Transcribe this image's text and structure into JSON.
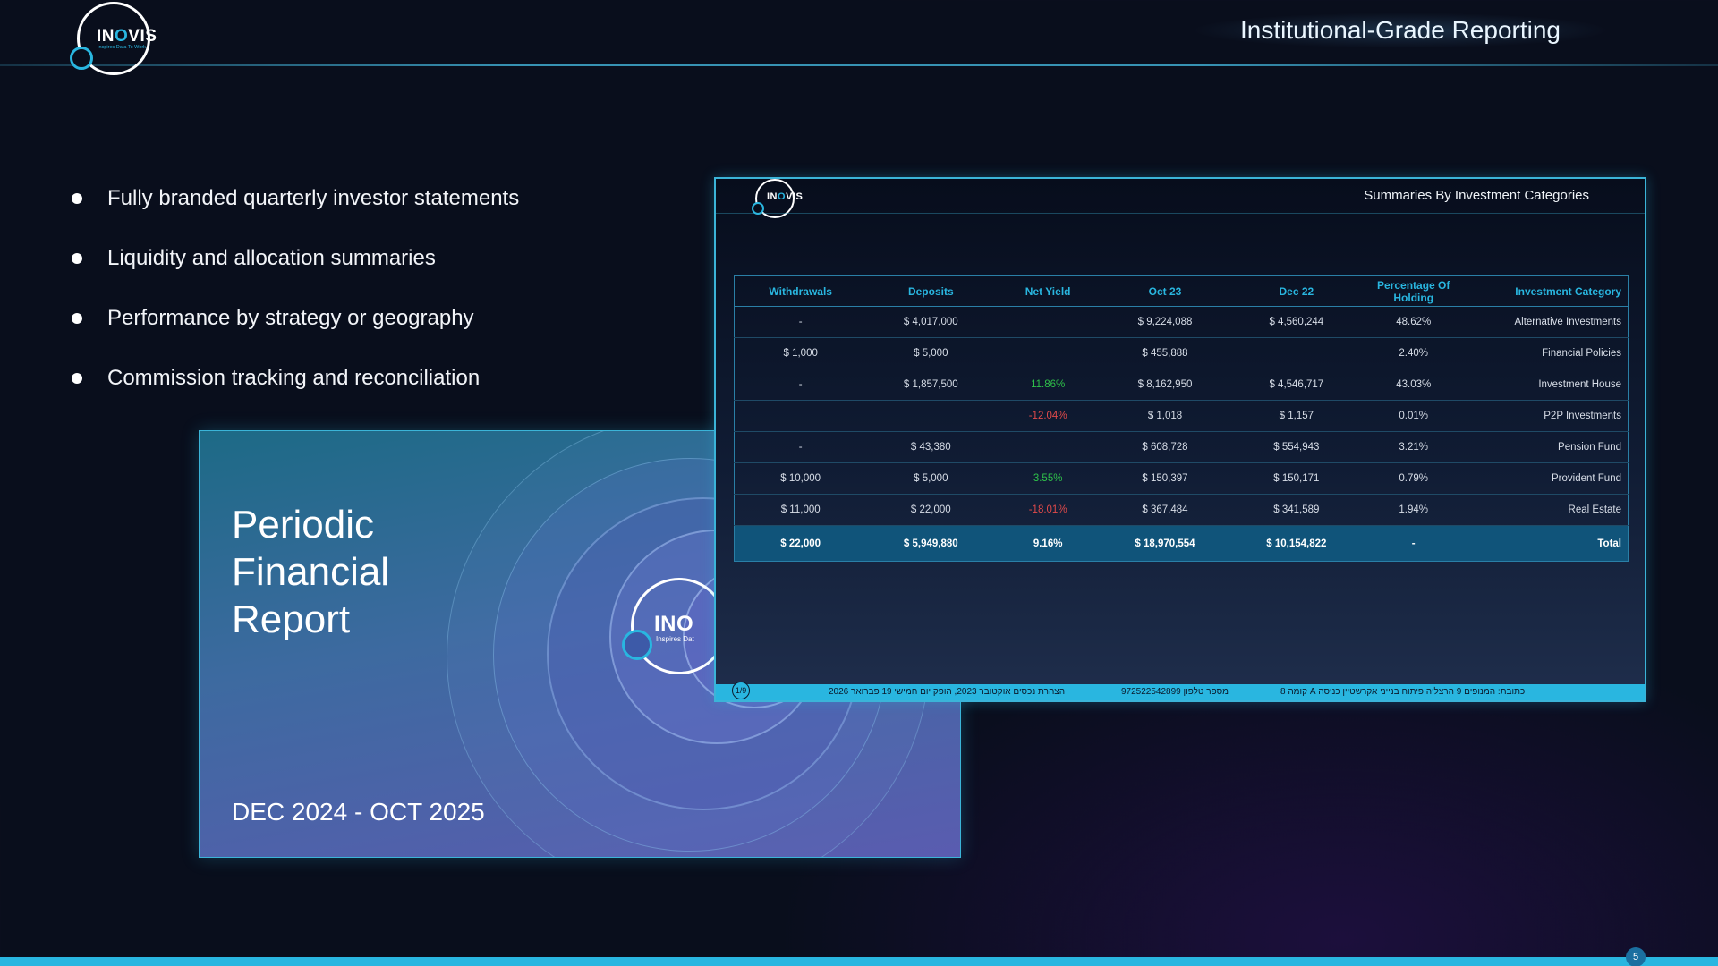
{
  "brand": {
    "name_pre": "IN",
    "name_o": "O",
    "name_post": "VIS",
    "tagline": "Inspires Data To Work",
    "accent_color": "#29b6e0",
    "background_color": "#090e1c"
  },
  "header": {
    "title": "Institutional-Grade Reporting"
  },
  "bullets": [
    "Fully branded quarterly investor statements",
    "Liquidity and allocation summaries",
    "Performance by strategy or geography",
    "Commission tracking and reconciliation"
  ],
  "cover": {
    "title_lines": [
      "Periodic",
      "Financial",
      "Report"
    ],
    "period": "DEC 2024 - OCT 2025",
    "brand_partial": "INO",
    "tagline_partial": "Inspires Dat"
  },
  "statement": {
    "heading": "Summaries By Investment Categories",
    "columns": [
      "Withdrawals",
      "Deposits",
      "Net Yield",
      "Oct 23",
      "Dec 22",
      "Percentage Of Holding",
      "Investment Category"
    ],
    "rows": [
      {
        "withdrawals": "-",
        "deposits": "$ 4,017,000",
        "net_yield": "",
        "oct23": "$ 9,224,088",
        "dec22": "$ 4,560,244",
        "pct": "48.62%",
        "category": "Alternative Investments"
      },
      {
        "withdrawals": "$ 1,000",
        "deposits": "$ 5,000",
        "net_yield": "",
        "oct23": "$ 455,888",
        "dec22": "",
        "pct": "2.40%",
        "category": "Financial Policies"
      },
      {
        "withdrawals": "-",
        "deposits": "$ 1,857,500",
        "net_yield": "11.86%",
        "oct23": "$ 8,162,950",
        "dec22": "$ 4,546,717",
        "pct": "43.03%",
        "category": "Investment House"
      },
      {
        "withdrawals": "",
        "deposits": "",
        "net_yield": "-12.04%",
        "oct23": "$ 1,018",
        "dec22": "$ 1,157",
        "pct": "0.01%",
        "category": "P2P Investments"
      },
      {
        "withdrawals": "-",
        "deposits": "$ 43,380",
        "net_yield": "",
        "oct23": "$ 608,728",
        "dec22": "$ 554,943",
        "pct": "3.21%",
        "category": "Pension Fund"
      },
      {
        "withdrawals": "$ 10,000",
        "deposits": "$ 5,000",
        "net_yield": "3.55%",
        "oct23": "$ 150,397",
        "dec22": "$ 150,171",
        "pct": "0.79%",
        "category": "Provident Fund"
      },
      {
        "withdrawals": "$ 11,000",
        "deposits": "$ 22,000",
        "net_yield": "-18.01%",
        "oct23": "$ 367,484",
        "dec22": "$ 341,589",
        "pct": "1.94%",
        "category": "Real Estate"
      }
    ],
    "total": {
      "withdrawals": "$ 22,000",
      "deposits": "$ 5,949,880",
      "net_yield": "9.16%",
      "oct23": "$ 18,970,554",
      "dec22": "$ 10,154,822",
      "pct": "-",
      "category": "Total"
    },
    "positive_color": "#2fc14a",
    "negative_color": "#e04a4a",
    "footer": {
      "page": "1/9",
      "report_note": "הצהרת נכסים אוקטובר 2023, הופק יום חמישי 19 פברואר 2026",
      "phone": "מספר טלפון 972522542899",
      "address": "כתובת: המנופים 9 הרצליה פיתוח בנייני אקרשטיין כניסה A קומה 8"
    }
  },
  "slide_number": "5"
}
